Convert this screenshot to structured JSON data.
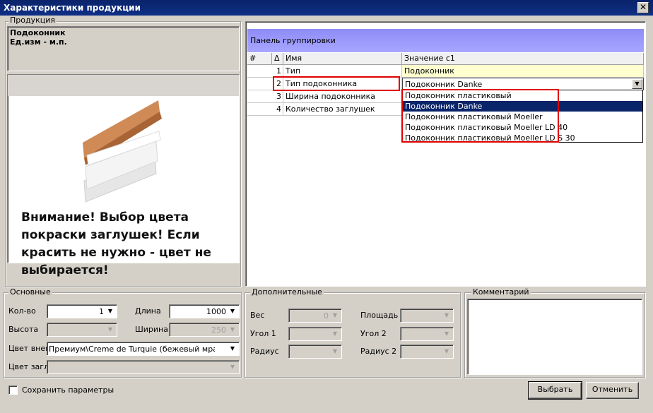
{
  "window": {
    "title": "Характеристики продукции",
    "close_glyph": "✕"
  },
  "product": {
    "group_label": "Продукция",
    "name": "Подоконник",
    "unit": "Ед.изм - м.п.",
    "notice": "Внимание! Выбор цвета покраски  заглушек!  Если красить не нужно - цвет не выбирается!"
  },
  "grid": {
    "group_panel": "Панель группировки",
    "columns": {
      "num": "#",
      "sort": "Δ",
      "name": "Имя",
      "value": "Значение с1"
    },
    "rows": [
      {
        "num": "1",
        "name": "Тип",
        "value": "Подоконник"
      },
      {
        "num": "2",
        "name": "Тип подоконника",
        "value": "Подоконник Danke"
      },
      {
        "num": "3",
        "name": "Ширина подоконника",
        "value": ""
      },
      {
        "num": "4",
        "name": "Количество заглушек",
        "value": ""
      }
    ],
    "dropdown": [
      {
        "label": "Подоконник пластиковый",
        "selected": false
      },
      {
        "label": "Подоконник Danke",
        "selected": true
      },
      {
        "label": "Подоконник пластиковый Moeller",
        "selected": false
      },
      {
        "label": "Подоконник пластиковый Moeller LD 40",
        "selected": false
      },
      {
        "label": "Подоконник пластиковый Moeller LD S 30",
        "selected": false
      }
    ]
  },
  "basic": {
    "group_label": "Основные",
    "qty_label": "Кол-во",
    "qty_value": "1",
    "length_label": "Длина",
    "length_value": "1000",
    "height_label": "Высота",
    "height_value": "",
    "width_label": "Ширина",
    "width_value": "250",
    "color_out_label": "Цвет внешн",
    "color_out_value": "Премиум\\Creme de Turquie (бежевый мрамо...",
    "color_cap_label": "Цвет заглу",
    "color_cap_value": ""
  },
  "extra": {
    "group_label": "Дополнительные",
    "weight_label": "Вес",
    "weight_value": "0",
    "area_label": "Площадь",
    "area_value": "",
    "angle1_label": "Угол 1",
    "angle1_value": "",
    "angle2_label": "Угол 2",
    "angle2_value": "",
    "radius_label": "Радиус",
    "radius_value": "",
    "radius2_label": "Радиус 2",
    "radius2_value": ""
  },
  "comment": {
    "group_label": "Комментарий",
    "value": ""
  },
  "footer": {
    "save_params": "Сохранить параметры",
    "select": "Выбрать",
    "cancel": "Отменить"
  },
  "colors": {
    "title_bg": "#0a246a",
    "group_panel": "#8e8cf6",
    "highlight_row": "#ffffd0",
    "red_box": "#e00000",
    "selection": "#0a246a"
  },
  "icons": {
    "close": "close-icon",
    "dropdown": "chevron-down-icon",
    "checkbox": "checkbox-icon"
  }
}
